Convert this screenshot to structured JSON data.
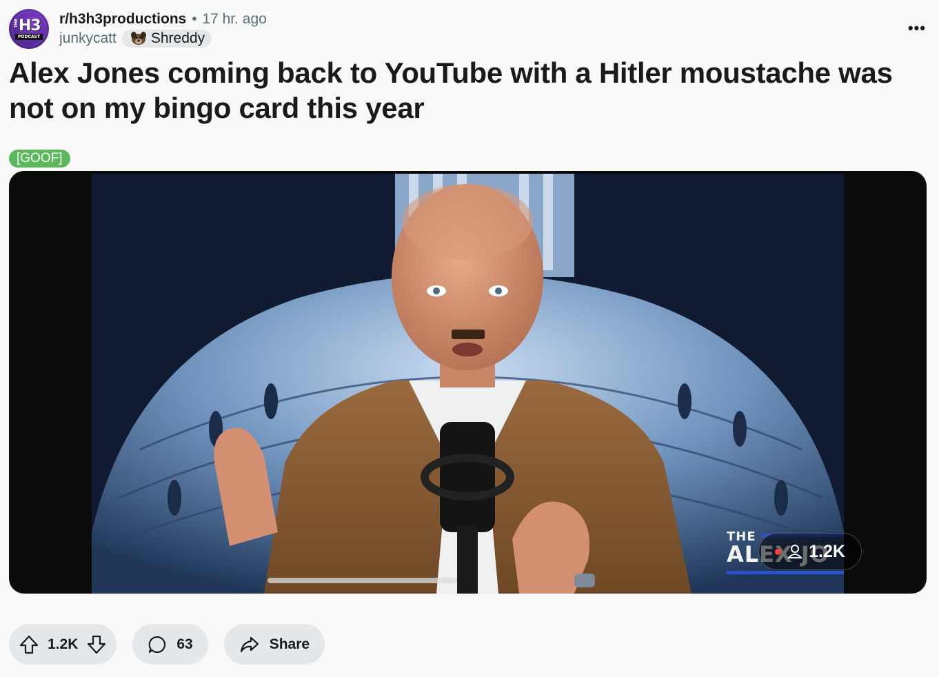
{
  "post": {
    "subreddit": "r/h3h3productions",
    "separator": "•",
    "age": "17 hr. ago",
    "author": "junkycatt",
    "user_flair": "Shreddy",
    "avatar": {
      "small_text": "THE",
      "main_text": "H3",
      "banner_text": "PODCAST"
    },
    "more_label": "•••",
    "title": "Alex Jones coming back to YouTube with a Hitler moustache was not on my bingo card this year",
    "flair_tag": "[GOOF]",
    "media": {
      "overlay_logo_top": "THE",
      "overlay_logo_name": "ALEX JO",
      "viewer_count": "1.2K"
    },
    "actions": {
      "score": "1.2K",
      "comments": "63",
      "share_label": "Share"
    }
  },
  "colors": {
    "background": "#f9f9f9",
    "pill": "#e5e8ea",
    "tag": "#5cb85c",
    "text": "#1a1a1b",
    "meta": "#576f76"
  }
}
